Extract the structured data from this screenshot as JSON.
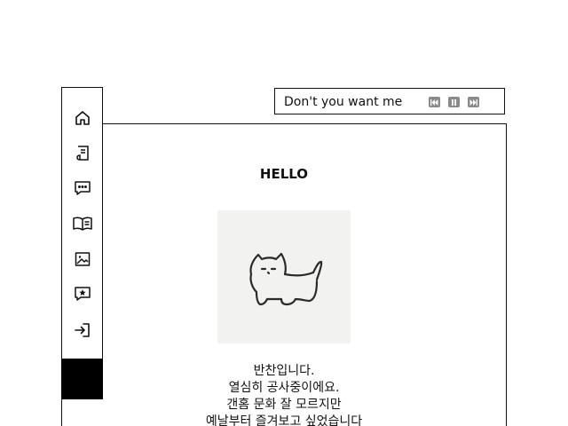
{
  "player": {
    "song_title": "Don't you want me (",
    "controls": [
      "previous-icon",
      "pause-icon",
      "next-icon"
    ]
  },
  "main": {
    "title": "HELLO",
    "intro_lines": [
      "반찬입니다.",
      "열심히 공사중이에요.",
      "갠홈 문화 잘 모르지만",
      "예날부터 즐겨보고 싶었습니다"
    ]
  },
  "sidebar": {
    "items": [
      "home-icon",
      "guestbook-icon",
      "chat-icon",
      "book-icon",
      "gallery-icon",
      "favorites-icon",
      "login-icon"
    ]
  },
  "colors": {
    "border": "#111111",
    "control_button": "#8a8a8a",
    "image_background": "#f2f2f0",
    "nav_block": "#000000"
  }
}
